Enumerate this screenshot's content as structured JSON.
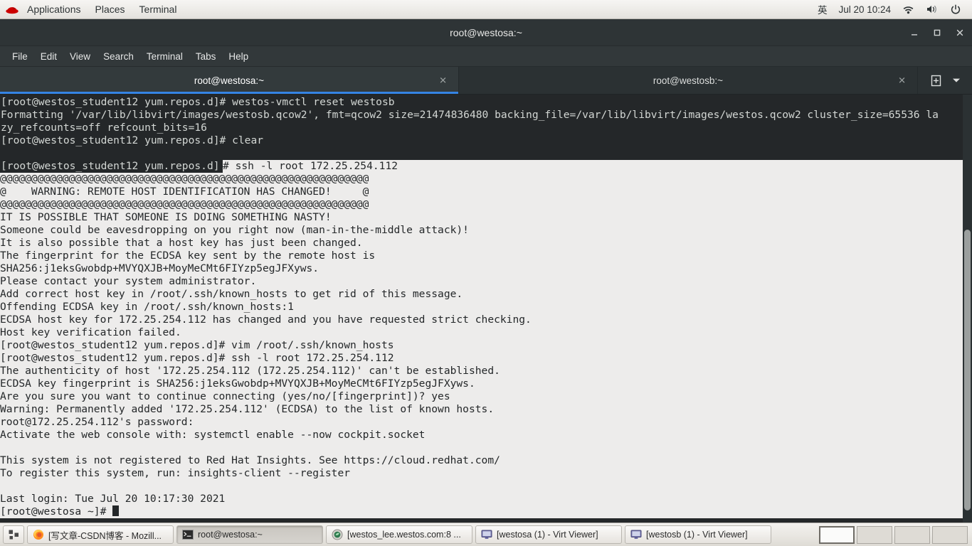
{
  "top_panel": {
    "logo_icon": "redhat-logo-icon",
    "menus": [
      "Applications",
      "Places",
      "Terminal"
    ],
    "right": {
      "input_method": "英",
      "clock": "Jul 20 10:24",
      "wifi_icon": "wifi-icon",
      "volume_icon": "volume-icon",
      "power_icon": "power-icon"
    }
  },
  "window": {
    "title": "root@westosa:~",
    "minimize_icon": "minimize-icon",
    "maximize_icon": "maximize-icon",
    "close_icon": "close-icon",
    "menubar": [
      "File",
      "Edit",
      "View",
      "Search",
      "Terminal",
      "Tabs",
      "Help"
    ],
    "tabs": [
      {
        "label": "root@westosa:~",
        "active": true,
        "close_icon": "close-icon"
      },
      {
        "label": "root@westosb:~",
        "active": false,
        "close_icon": "close-icon"
      }
    ],
    "new_tab_icon": "new-tab-icon",
    "tab_menu_icon": "chevron-down-icon"
  },
  "terminal": {
    "unselected_lines": [
      "[root@westos_student12 yum.repos.d]# westos-vmctl reset westosb",
      "Formatting '/var/lib/libvirt/images/westosb.qcow2', fmt=qcow2 size=21474836480 backing_file=/var/lib/libvirt/images/westos.qcow2 cluster_size=65536 la",
      "zy_refcounts=off refcount_bits=16",
      "[root@westos_student12 yum.repos.d]# clear",
      ""
    ],
    "prompt_line_prefix": "[root@westos_student12 yum.repos.d]",
    "selected_lines": [
      "# ssh -l root 172.25.254.112",
      "@@@@@@@@@@@@@@@@@@@@@@@@@@@@@@@@@@@@@@@@@@@@@@@@@@@@@@@@@@@",
      "@    WARNING: REMOTE HOST IDENTIFICATION HAS CHANGED!     @",
      "@@@@@@@@@@@@@@@@@@@@@@@@@@@@@@@@@@@@@@@@@@@@@@@@@@@@@@@@@@@",
      "IT IS POSSIBLE THAT SOMEONE IS DOING SOMETHING NASTY!",
      "Someone could be eavesdropping on you right now (man-in-the-middle attack)!",
      "It is also possible that a host key has just been changed.",
      "The fingerprint for the ECDSA key sent by the remote host is",
      "SHA256:j1eksGwobdp+MVYQXJB+MoyMeCMt6FIYzp5egJFXyws.",
      "Please contact your system administrator.",
      "Add correct host key in /root/.ssh/known_hosts to get rid of this message.",
      "Offending ECDSA key in /root/.ssh/known_hosts:1",
      "ECDSA host key for 172.25.254.112 has changed and you have requested strict checking.",
      "Host key verification failed.",
      "[root@westos_student12 yum.repos.d]# vim /root/.ssh/known_hosts",
      "[root@westos_student12 yum.repos.d]# ssh -l root 172.25.254.112",
      "The authenticity of host '172.25.254.112 (172.25.254.112)' can't be established.",
      "ECDSA key fingerprint is SHA256:j1eksGwobdp+MVYQXJB+MoyMeCMt6FIYzp5egJFXyws.",
      "Are you sure you want to continue connecting (yes/no/[fingerprint])? yes",
      "Warning: Permanently added '172.25.254.112' (ECDSA) to the list of known hosts.",
      "root@172.25.254.112's password:",
      "Activate the web console with: systemctl enable --now cockpit.socket",
      "",
      "This system is not registered to Red Hat Insights. See https://cloud.redhat.com/",
      "To register this system, run: insights-client --register",
      "",
      "Last login: Tue Jul 20 10:17:30 2021",
      "[root@westosa ~]# "
    ],
    "colors": {
      "background": "#242729",
      "foreground": "#d3d7d4",
      "selection_background": "#edeceb",
      "selection_foreground": "#242729",
      "tab_accent": "#3584e4"
    }
  },
  "taskbar": {
    "show_desktop_icon": "show-desktop-icon",
    "tasks": [
      {
        "icon": "firefox-icon",
        "label": "[写文章-CSDN博客 - Mozill...",
        "active": false
      },
      {
        "icon": "terminal-icon",
        "label": "root@westosa:~",
        "active": true
      },
      {
        "icon": "virt-manager-icon",
        "label": "[westos_lee.westos.com:8 ...",
        "active": false
      },
      {
        "icon": "virt-viewer-icon",
        "label": "[westosa (1) - Virt Viewer]",
        "active": false
      },
      {
        "icon": "virt-viewer-icon",
        "label": "[westosb (1) - Virt Viewer]",
        "active": false
      }
    ],
    "workspaces": [
      {
        "name": "workspace-1",
        "active": true
      },
      {
        "name": "workspace-2",
        "active": false
      },
      {
        "name": "workspace-3",
        "active": false
      },
      {
        "name": "workspace-4",
        "active": false
      }
    ]
  }
}
